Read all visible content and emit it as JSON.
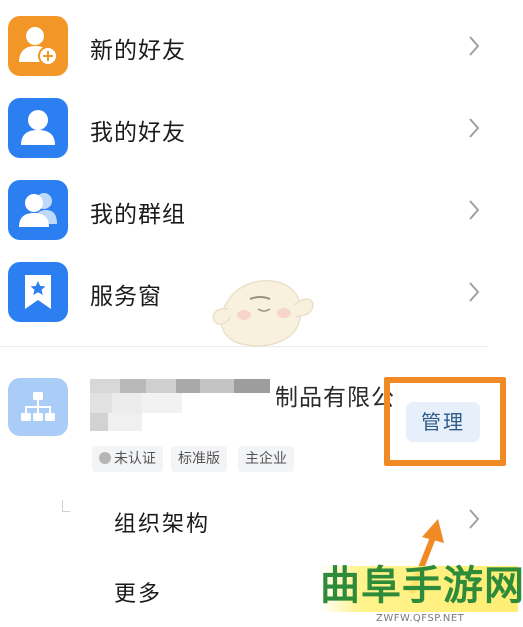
{
  "menu": {
    "items": [
      {
        "label": "新的好友",
        "icon": "add-contact-icon",
        "color": "#f29727"
      },
      {
        "label": "我的好友",
        "icon": "person-icon",
        "color": "#2b7ff0"
      },
      {
        "label": "我的群组",
        "icon": "group-icon",
        "color": "#2b7ff0"
      },
      {
        "label": "服务窗",
        "icon": "bookmark-star-icon",
        "color": "#2b7ff0"
      }
    ]
  },
  "org": {
    "icon": "org-chart-icon",
    "icon_color": "#a9cdf6",
    "name_visible": "制品有限公",
    "tags": [
      "未认证",
      "标准版",
      "主企业"
    ],
    "manage_label": "管理",
    "highlight_color": "#f08a24"
  },
  "sub_items": [
    {
      "label": "组织架构"
    },
    {
      "label": "更多"
    }
  ],
  "watermark": {
    "text": "曲阜手游网",
    "url": "ZWFW.QFSP.NET",
    "color": "#2e8b3a"
  }
}
